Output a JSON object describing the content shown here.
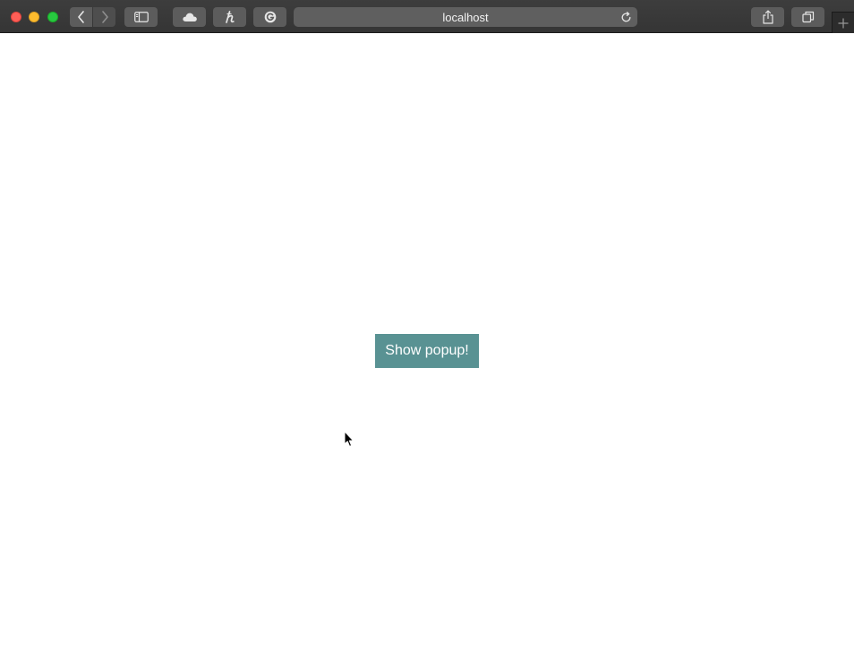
{
  "browser": {
    "address_text": "localhost",
    "icons": {
      "back": "chevron-left-icon",
      "forward": "chevron-right-icon",
      "sidebar": "sidebar-icon",
      "cloud": "cloud-icon",
      "extension_h": "h-extension-icon",
      "grammarly": "grammarly-icon",
      "reload": "reload-icon",
      "share": "share-icon",
      "tabs": "tab-overview-icon",
      "new_tab": "plus-icon"
    },
    "colors": {
      "toolbar": "#3a3a3a",
      "button": "#5c5c5c",
      "close": "#fe5f57",
      "minimize": "#febc2e",
      "maximize": "#28c840"
    }
  },
  "page": {
    "popup_button_label": "Show popup!",
    "popup_button_color": "#599293"
  }
}
